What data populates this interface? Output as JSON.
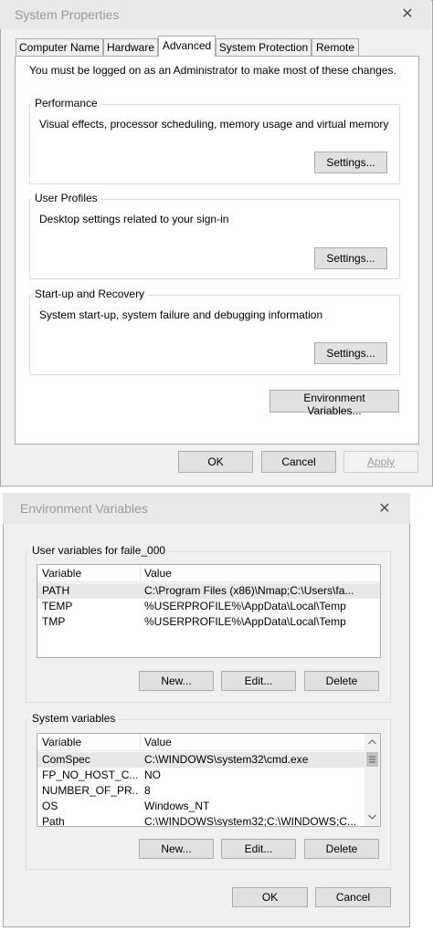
{
  "system_properties": {
    "title": "System Properties",
    "close_glyph": "✕",
    "tabs": [
      {
        "label": "Computer Name"
      },
      {
        "label": "Hardware"
      },
      {
        "label": "Advanced"
      },
      {
        "label": "System Protection"
      },
      {
        "label": "Remote"
      }
    ],
    "active_tab": "Advanced",
    "admin_note": "You must be logged on as an Administrator to make most of these changes.",
    "groups": [
      {
        "title": "Performance",
        "description": "Visual effects, processor scheduling, memory usage and virtual memory",
        "button": "Settings..."
      },
      {
        "title": "User Profiles",
        "description": "Desktop settings related to your sign-in",
        "button": "Settings..."
      },
      {
        "title": "Start-up and Recovery",
        "description": "System start-up, system failure and debugging information",
        "button": "Settings..."
      }
    ],
    "env_button": "Environment Variables...",
    "ok": "OK",
    "cancel": "Cancel",
    "apply": "Apply"
  },
  "environment_variables": {
    "title": "Environment Variables",
    "close_glyph": "✕",
    "user_section": {
      "title": "User variables for faile_000",
      "columns": [
        "Variable",
        "Value"
      ],
      "rows": [
        {
          "variable": "PATH",
          "value": "C:\\Program Files (x86)\\Nmap;C:\\Users\\fa...",
          "selected": true
        },
        {
          "variable": "TEMP",
          "value": "%USERPROFILE%\\AppData\\Local\\Temp",
          "selected": false
        },
        {
          "variable": "TMP",
          "value": "%USERPROFILE%\\AppData\\Local\\Temp",
          "selected": false
        }
      ],
      "buttons": {
        "new": "New...",
        "edit": "Edit...",
        "delete": "Delete"
      }
    },
    "system_section": {
      "title": "System variables",
      "columns": [
        "Variable",
        "Value"
      ],
      "rows": [
        {
          "variable": "ComSpec",
          "value": "C:\\WINDOWS\\system32\\cmd.exe",
          "selected": true
        },
        {
          "variable": "FP_NO_HOST_C...",
          "value": "NO",
          "selected": false
        },
        {
          "variable": "NUMBER_OF_PR...",
          "value": "8",
          "selected": false
        },
        {
          "variable": "OS",
          "value": "Windows_NT",
          "selected": false
        },
        {
          "variable": "Path",
          "value": "C:\\WINDOWS\\system32;C:\\WINDOWS;C...",
          "selected": false
        }
      ],
      "buttons": {
        "new": "New...",
        "edit": "Edit...",
        "delete": "Delete"
      }
    },
    "ok": "OK",
    "cancel": "Cancel"
  }
}
